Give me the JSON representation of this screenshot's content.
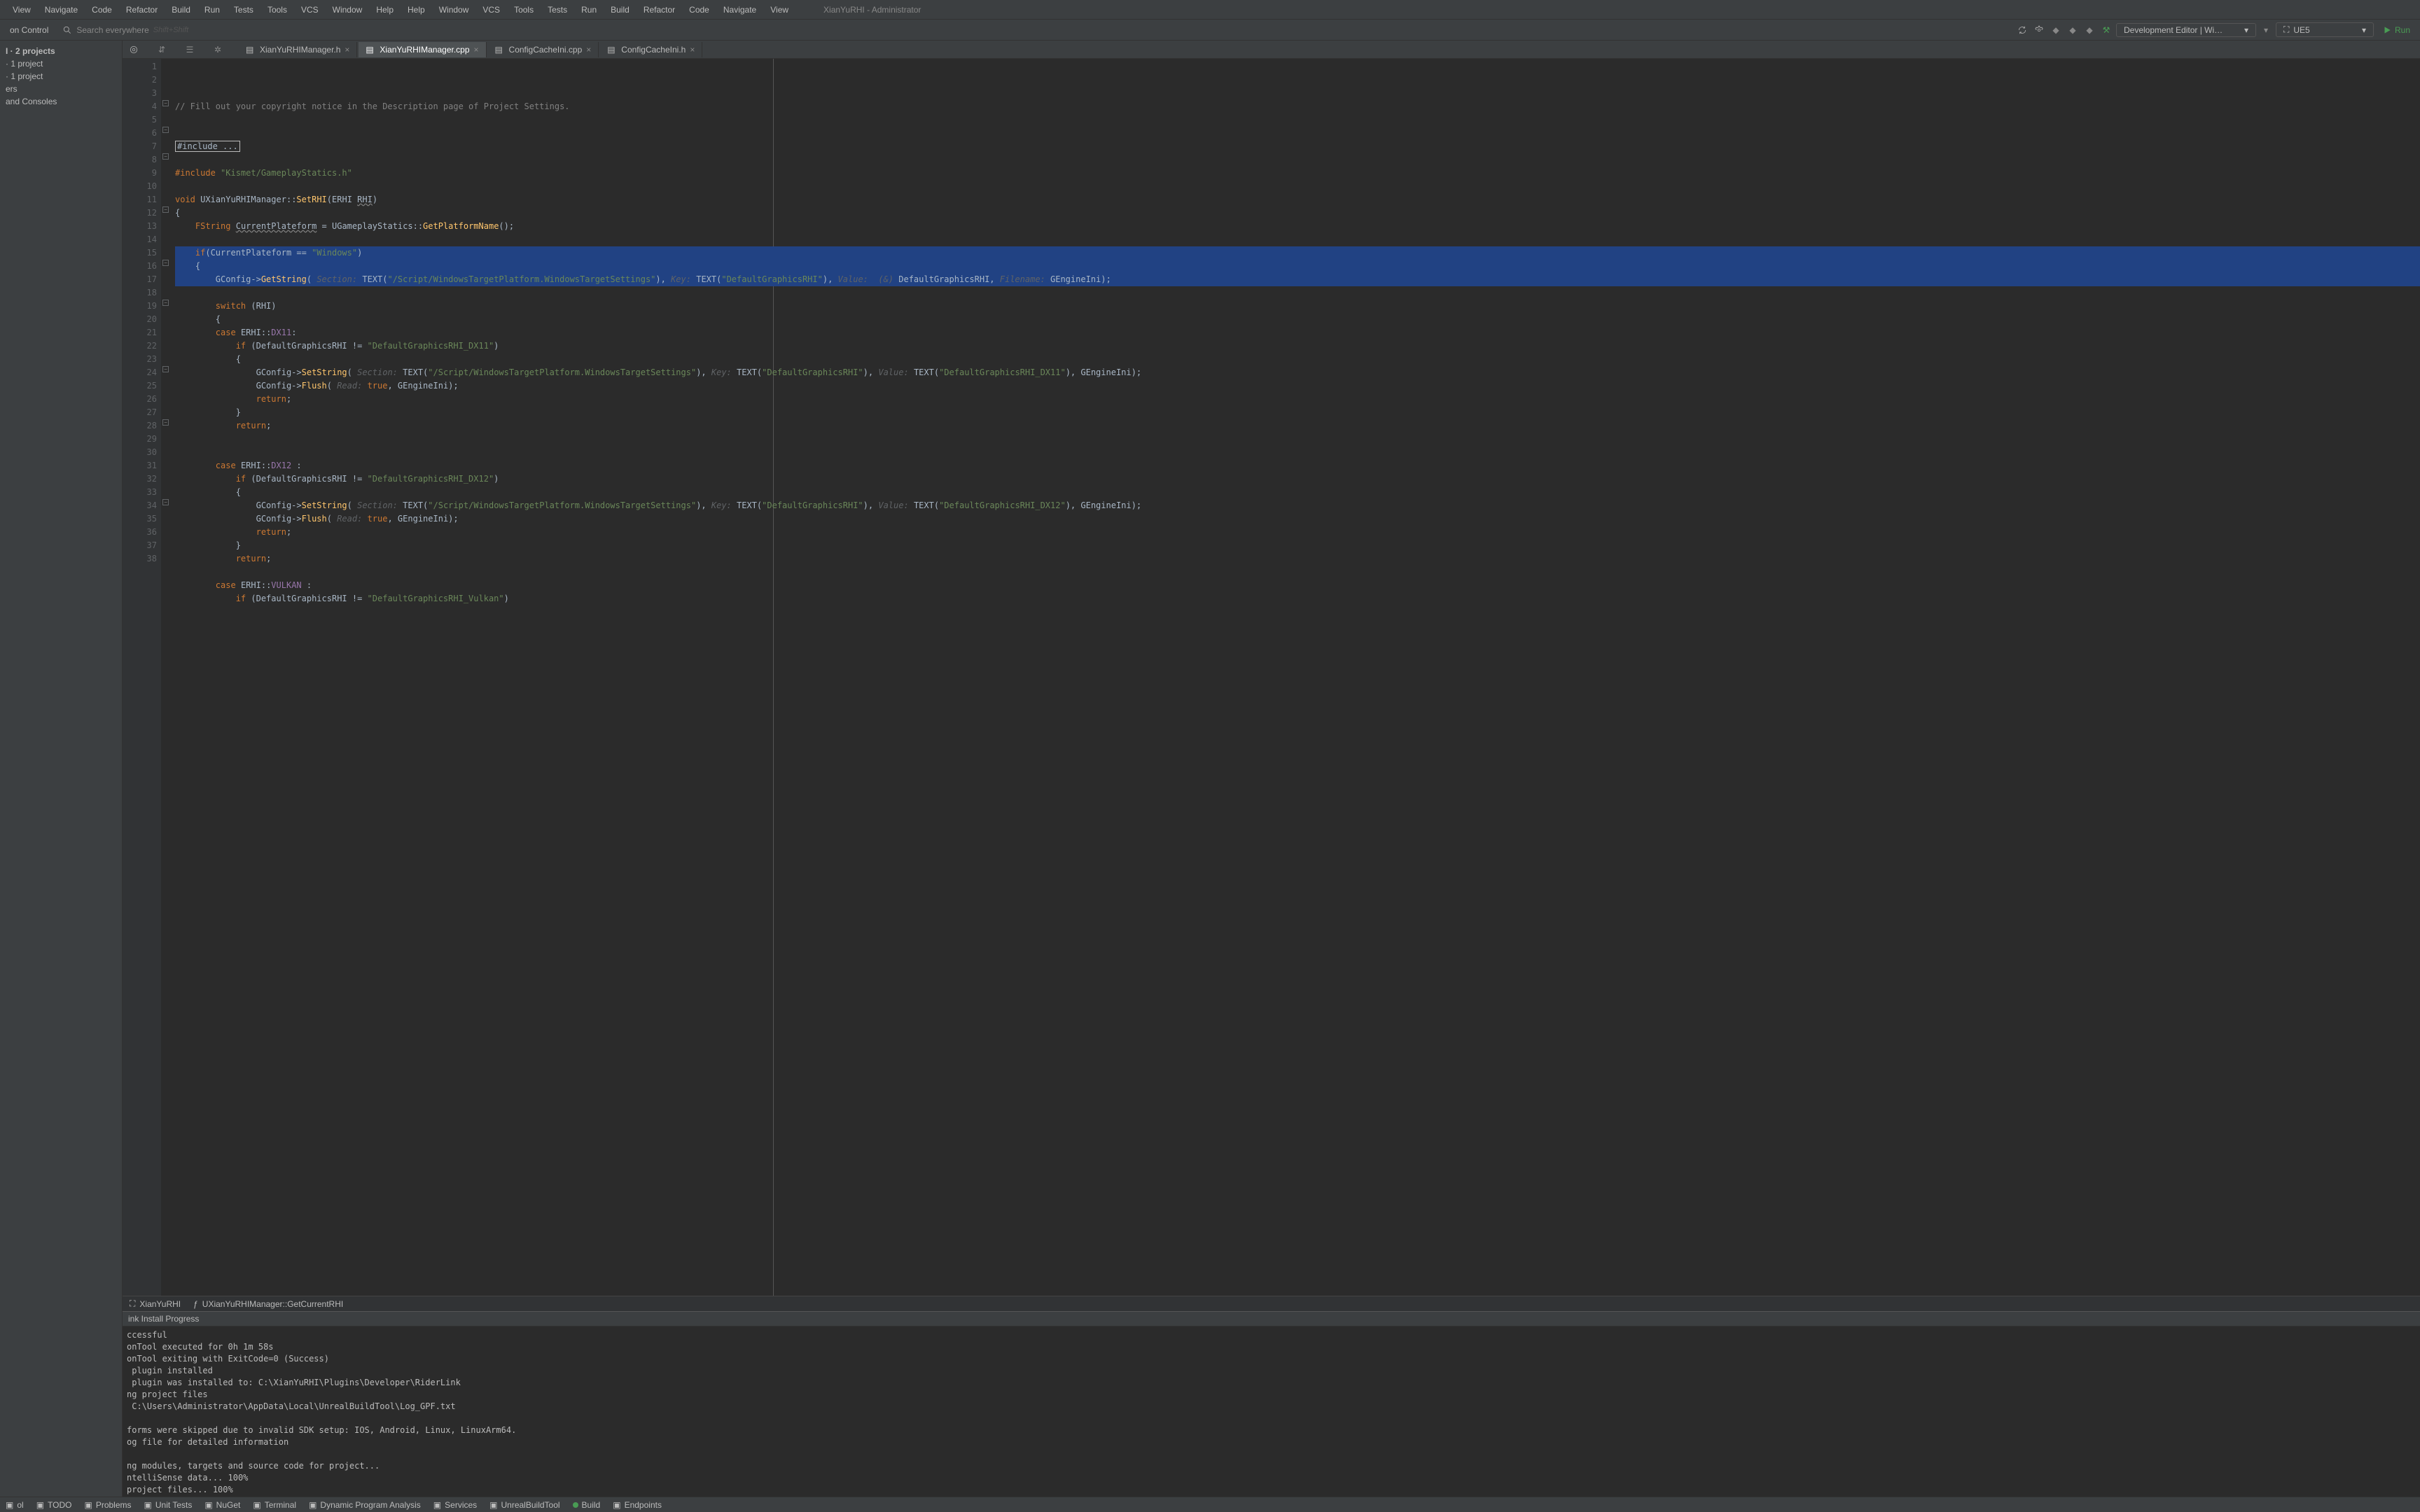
{
  "app_title": "XianYuRHI - Administrator",
  "menu": [
    "View",
    "Navigate",
    "Code",
    "Refactor",
    "Build",
    "Run",
    "Tests",
    "Tools",
    "VCS",
    "Window",
    "Help"
  ],
  "toolbar": {
    "vc_label": "on Control",
    "search_placeholder": "Search everywhere",
    "search_hint": "Shift+Shift",
    "config_label": "Development Editor | Wi…",
    "target_label": "UE5",
    "run_label": "Run"
  },
  "left_tree": {
    "head": "I · 2 projects",
    "items": [
      "· 1 project",
      "· 1 project",
      "ers",
      "and Consoles"
    ]
  },
  "tabs": [
    {
      "label": "XianYuRHIManager.h",
      "active": false
    },
    {
      "label": "XianYuRHIManager.cpp",
      "active": true
    },
    {
      "label": "ConfigCacheIni.cpp",
      "active": false
    },
    {
      "label": "ConfigCacheIni.h",
      "active": false
    }
  ],
  "lines_start": 1,
  "code_lines": [
    {
      "n": 1,
      "html": "<span class='cmt'>// Fill out your copyright notice in the Description page of Project Settings.</span>"
    },
    {
      "n": 2,
      "html": ""
    },
    {
      "n": 3,
      "html": ""
    },
    {
      "n": 4,
      "html": "<span class='boxed'>#include ...</span>"
    },
    {
      "n": 5,
      "html": ""
    },
    {
      "n": 6,
      "html": "<span class='kw'>#include</span> <span class='str'>\"Kismet/GameplayStatics.h\"</span>"
    },
    {
      "n": 7,
      "html": ""
    },
    {
      "n": 8,
      "html": "<span class='kw'>void</span> <span class='type'>UXianYuRHIManager</span>::<span class='fn'>SetRHI</span>(<span class='type'>ERHI</span> <span class='wavy'>RHI</span>)"
    },
    {
      "n": 9,
      "html": "{"
    },
    {
      "n": 10,
      "html": "    <span class='kw'>FString</span> <span class='wavy'>CurrentPlateform</span> = <span class='type'>UGameplayStatics</span>::<span class='fn'>GetPlatformName</span>();"
    },
    {
      "n": 11,
      "html": ""
    },
    {
      "n": 12,
      "sel": true,
      "html": "    <span class='kw'>if</span>(CurrentPlateform == <span class='str'>\"Windows\"</span>)"
    },
    {
      "n": 13,
      "sel": true,
      "html": "    {"
    },
    {
      "n": 14,
      "sel": true,
      "html": "        GConfig-&gt;<span class='fn'>GetString</span>( <span class='hint'>Section:</span> <span class='type'>TEXT</span>(<span class='str'>\"/Script/WindowsTargetPlatform.WindowsTargetSettings\"</span>), <span class='hint'>Key:</span> <span class='type'>TEXT</span>(<span class='str'>\"DefaultGraphicsRHI\"</span>), <span class='hint'>Value:  (&)</span> DefaultGraphicsRHI, <span class='hint'>Filename:</span> GEngineIni);"
    },
    {
      "n": 15,
      "html": ""
    },
    {
      "n": 16,
      "html": "        <span class='kw'>switch</span> (RHI)"
    },
    {
      "n": 17,
      "html": "        {"
    },
    {
      "n": 18,
      "html": "        <span class='kw'>case</span> <span class='type'>ERHI</span>::<span class='enum'>DX11</span>:"
    },
    {
      "n": 19,
      "html": "            <span class='kw'>if</span> (DefaultGraphicsRHI != <span class='str'>\"DefaultGraphicsRHI_DX11\"</span>)"
    },
    {
      "n": 20,
      "html": "            {"
    },
    {
      "n": 21,
      "html": "                GConfig-&gt;<span class='fn'>SetString</span>( <span class='hint'>Section:</span> <span class='type'>TEXT</span>(<span class='str'>\"/Script/WindowsTargetPlatform.WindowsTargetSettings\"</span>), <span class='hint'>Key:</span> <span class='type'>TEXT</span>(<span class='str'>\"DefaultGraphicsRHI\"</span>), <span class='hint'>Value:</span> <span class='type'>TEXT</span>(<span class='str'>\"DefaultGraphicsRHI_DX11\"</span>), GEngineIni);"
    },
    {
      "n": 22,
      "html": "                GConfig-&gt;<span class='fn'>Flush</span>( <span class='hint'>Read:</span> <span class='kw'>true</span>, GEngineIni);"
    },
    {
      "n": 23,
      "html": "                <span class='kw'>return</span>;"
    },
    {
      "n": 24,
      "html": "            }"
    },
    {
      "n": 25,
      "html": "            <span class='kw'>return</span>;"
    },
    {
      "n": 26,
      "html": ""
    },
    {
      "n": 27,
      "html": ""
    },
    {
      "n": 28,
      "html": "        <span class='kw'>case</span> <span class='type'>ERHI</span>::<span class='enum'>DX12</span> :"
    },
    {
      "n": 29,
      "html": "            <span class='kw'>if</span> (DefaultGraphicsRHI != <span class='str'>\"DefaultGraphicsRHI_DX12\"</span>)"
    },
    {
      "n": 30,
      "html": "            {"
    },
    {
      "n": 31,
      "html": "                GConfig-&gt;<span class='fn'>SetString</span>( <span class='hint'>Section:</span> <span class='type'>TEXT</span>(<span class='str'>\"/Script/WindowsTargetPlatform.WindowsTargetSettings\"</span>), <span class='hint'>Key:</span> <span class='type'>TEXT</span>(<span class='str'>\"DefaultGraphicsRHI\"</span>), <span class='hint'>Value:</span> <span class='type'>TEXT</span>(<span class='str'>\"DefaultGraphicsRHI_DX12\"</span>), GEngineIni);"
    },
    {
      "n": 32,
      "html": "                GConfig-&gt;<span class='fn'>Flush</span>( <span class='hint'>Read:</span> <span class='kw'>true</span>, GEngineIni);"
    },
    {
      "n": 33,
      "html": "                <span class='kw'>return</span>;"
    },
    {
      "n": 34,
      "html": "            }"
    },
    {
      "n": 35,
      "html": "            <span class='kw'>return</span>;"
    },
    {
      "n": 36,
      "html": ""
    },
    {
      "n": 37,
      "html": "        <span class='kw'>case</span> <span class='type'>ERHI</span>::<span class='enum'>VULKAN</span> :"
    },
    {
      "n": 38,
      "html": "            <span class='kw'>if</span> (DefaultGraphicsRHI != <span class='str'>\"DefaultGraphicsRHI_Vulkan\"</span>)"
    }
  ],
  "breadcrumb": [
    {
      "icon": "ue",
      "label": "XianYuRHI"
    },
    {
      "icon": "fn",
      "label": "UXianYuRHIManager::GetCurrentRHI"
    }
  ],
  "build": {
    "title": "ink Install Progress",
    "output": "ccessful\nonTool executed for 0h 1m 58s\nonTool exiting with ExitCode=0 (Success)\n plugin installed\n plugin was installed to: C:\\XianYuRHI\\Plugins\\Developer\\RiderLink\nng project files\n C:\\Users\\Administrator\\AppData\\Local\\UnrealBuildTool\\Log_GPF.txt\n\nforms were skipped due to invalid SDK setup: IOS, Android, Linux, LinuxArm64.\nog file for detailed information\n\nng modules, targets and source code for project...\nntelliSense data... 100%\nproject files... 100%"
  },
  "status": [
    "ol",
    "TODO",
    "Problems",
    "Unit Tests",
    "NuGet",
    "Terminal",
    "Dynamic Program Analysis",
    "Services",
    "UnrealBuildTool",
    "Build",
    "Endpoints"
  ]
}
